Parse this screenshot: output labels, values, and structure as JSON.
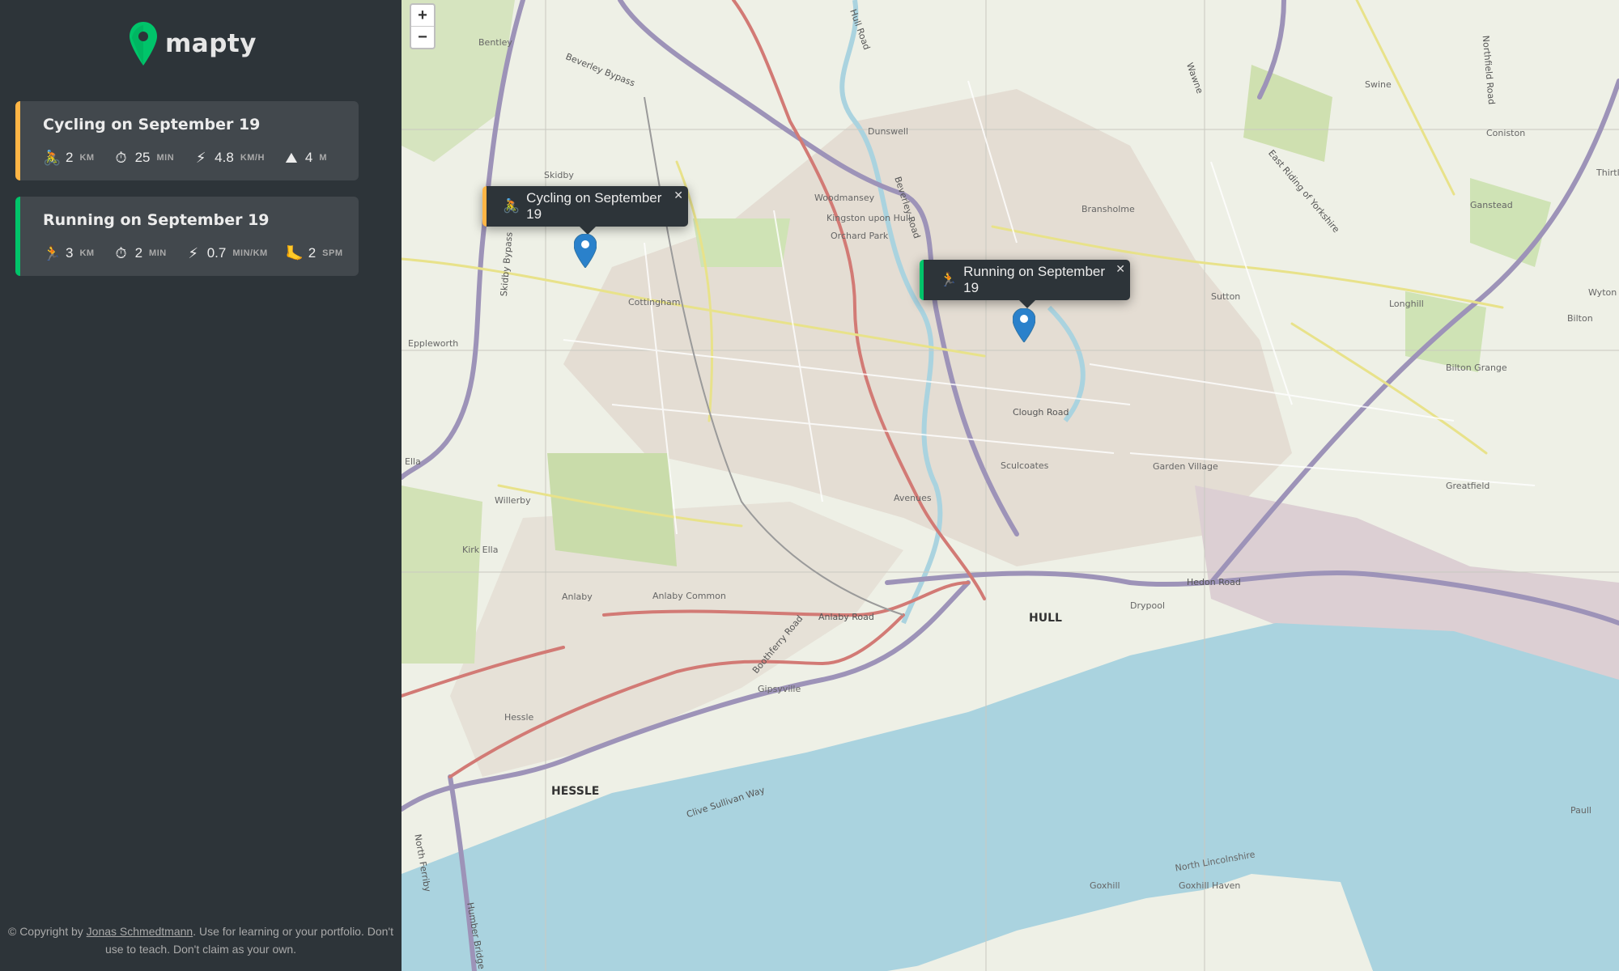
{
  "app": {
    "name": "mapty"
  },
  "workouts": [
    {
      "type": "cycling",
      "title": "Cycling on September 19",
      "color": "#ffb545",
      "details": [
        {
          "icon": "🚴",
          "value": "2",
          "unit": "km"
        },
        {
          "icon": "⏱",
          "value": "25",
          "unit": "min"
        },
        {
          "icon": "⚡",
          "value": "4.8",
          "unit": "km/h"
        },
        {
          "icon": "⛰",
          "value": "4",
          "unit": "m"
        }
      ]
    },
    {
      "type": "running",
      "title": "Running on September 19",
      "color": "#00c46a",
      "details": [
        {
          "icon": "🏃",
          "value": "3",
          "unit": "km"
        },
        {
          "icon": "⏱",
          "value": "2",
          "unit": "min"
        },
        {
          "icon": "⚡",
          "value": "0.7",
          "unit": "min/km"
        },
        {
          "icon": "🦶",
          "value": "2",
          "unit": "spm"
        }
      ]
    }
  ],
  "popups": {
    "cycling": {
      "icon": "🚴",
      "text": "Cycling on September 19"
    },
    "running": {
      "icon": "🏃",
      "text": "Running on September 19"
    }
  },
  "map": {
    "zoom_in": "+",
    "zoom_out": "−",
    "close": "✕",
    "labels": [
      "Bentley",
      "Beverley Bypass",
      "Hull Road",
      "Beverley Road",
      "Skidby",
      "Skidby Bypass",
      "Cottingham",
      "Woodmansey",
      "Kingston upon Hull",
      "Orchard Park",
      "Dunswell",
      "Bransholme",
      "Swine",
      "Wawne",
      "East Riding of Yorkshire",
      "Northfield Road",
      "Coniston",
      "Ganstead",
      "Sutton",
      "Longhill",
      "Wyton",
      "Bilton",
      "Bilton Grange",
      "Eppleworth",
      "Clough Road",
      "Sculcoates",
      "Garden Village",
      "Greatfield",
      "Avenues",
      "Willerby",
      "Kirk Ella",
      "Ella",
      "Anlaby",
      "Anlaby Common",
      "Anlaby Road",
      "Boothferry Road",
      "Gipsyville",
      "HULL",
      "Hedon Road",
      "Drypool",
      "Hessle",
      "HESSLE",
      "Clive Sullivan Way",
      "North Ferriby",
      "Humber Bridge",
      "North Lincolnshire",
      "Goxhill",
      "Goxhill Haven",
      "Paull",
      "Thirtleby"
    ]
  },
  "footer": {
    "prefix": "© Copyright by ",
    "author": "Jonas Schmedtmann",
    "suffix": ". Use for learning or your portfolio. Don't use to teach. Don't claim as your own."
  },
  "colors": {
    "sidebar_bg": "#2d3439",
    "card_bg": "#42484d",
    "brand_green": "#00c46a",
    "cycling_accent": "#ffb545",
    "running_accent": "#00c46a",
    "marker_blue": "#2a81cb",
    "water": "#aad3df"
  }
}
